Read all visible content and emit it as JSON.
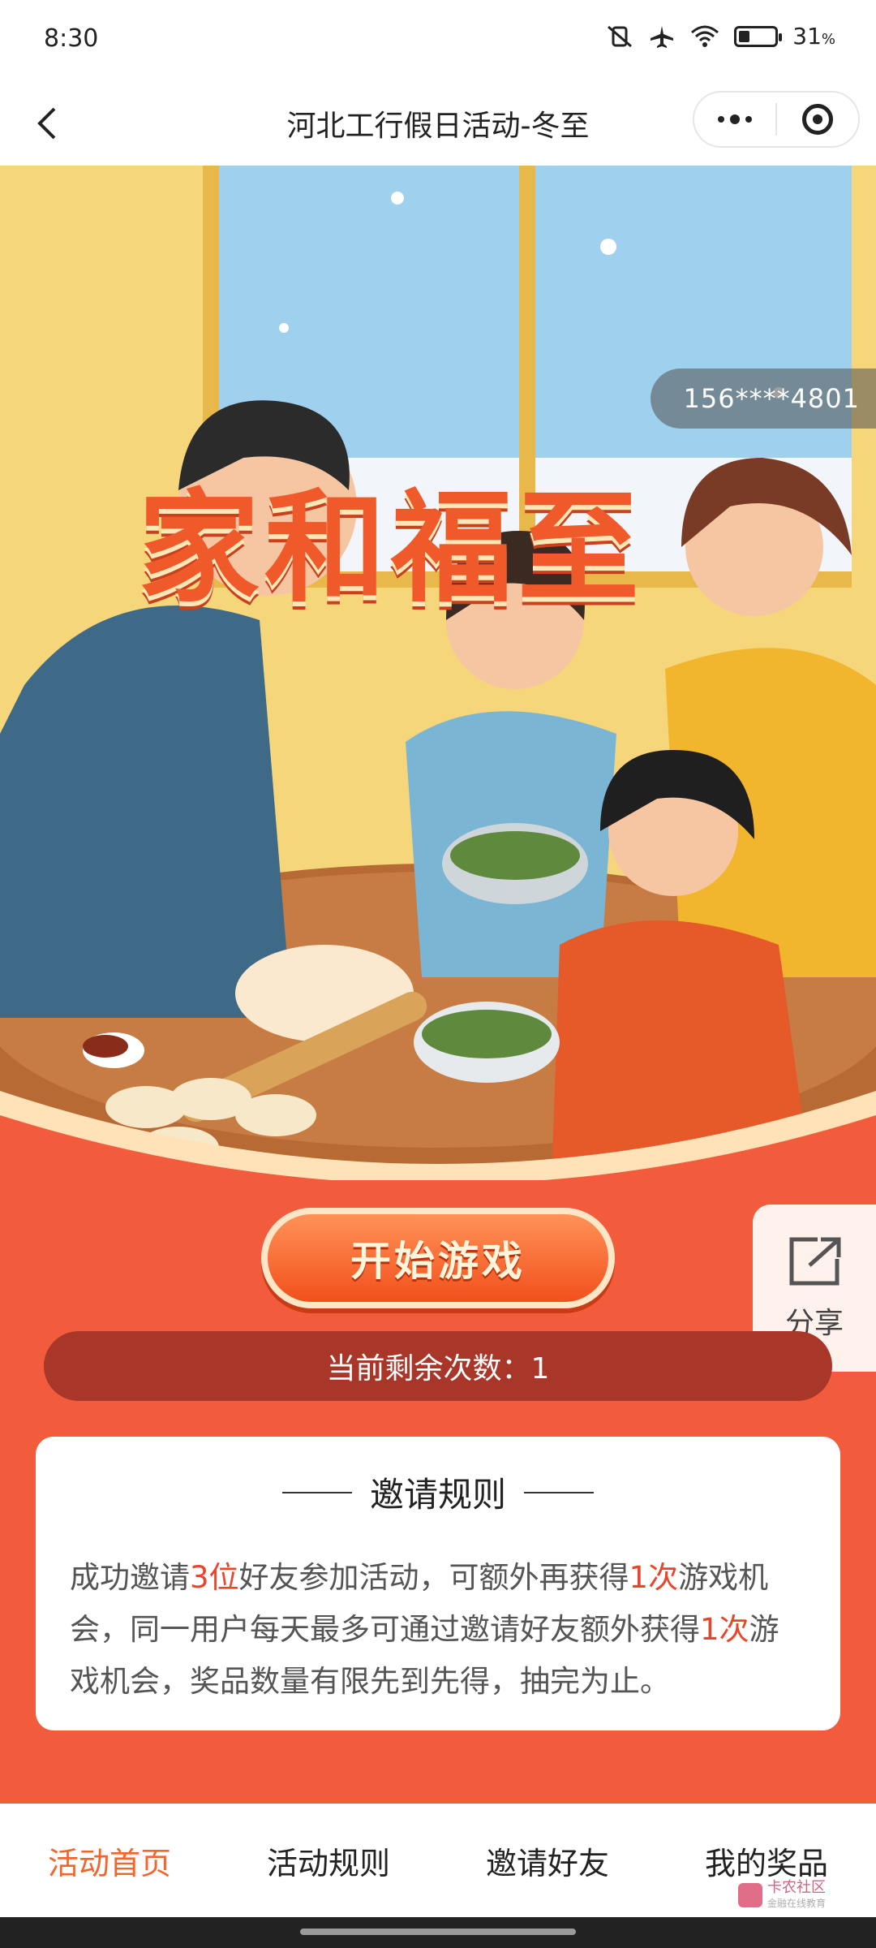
{
  "status_bar": {
    "time": "8:30",
    "battery_percent": "31",
    "battery_level": 0.31
  },
  "nav": {
    "title": "河北工行假日活动-冬至"
  },
  "banner": {
    "phone": "156****4801",
    "title_art": "家和福至"
  },
  "share": {
    "label": "分享"
  },
  "start_button": {
    "label": "开始游戏"
  },
  "remaining": {
    "text": "当前剩余次数：1"
  },
  "rules": {
    "title": "邀请规则",
    "segments": [
      {
        "text": "成功邀请",
        "highlight": false
      },
      {
        "text": "3位",
        "highlight": true
      },
      {
        "text": "好友参加活动，可额外再获得",
        "highlight": false
      },
      {
        "text": "1次",
        "highlight": true
      },
      {
        "text": "游戏机会，同一用户每天最多可通过邀请好友额外获得",
        "highlight": false
      },
      {
        "text": "1次",
        "highlight": true
      },
      {
        "text": "游戏机会，奖品数量有限先到先得，抽完为止。",
        "highlight": false
      }
    ]
  },
  "tabs": [
    {
      "label": "活动首页",
      "active": true
    },
    {
      "label": "活动规则",
      "active": false
    },
    {
      "label": "邀请好友",
      "active": false
    },
    {
      "label": "我的奖品",
      "active": false
    }
  ],
  "watermark": {
    "title": "卡农社区",
    "subtitle": "金融在线教育"
  },
  "colors": {
    "accent": "#f25c3d",
    "highlight": "#e8452a",
    "active_tab": "#f2662e"
  }
}
